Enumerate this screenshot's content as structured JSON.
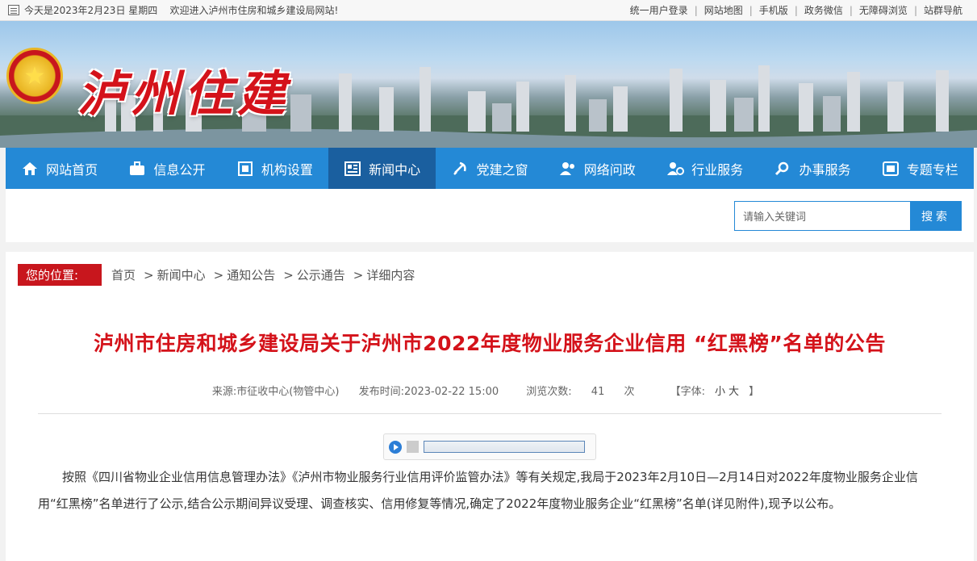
{
  "topbar": {
    "greeting": "今天是2023年2月23日 星期四    欢迎进入泸州市住房和城乡建设局网站!",
    "links": [
      "统一用户登录",
      "网站地图",
      "手机版",
      "政务微信",
      "无障碍浏览",
      "站群导航"
    ]
  },
  "banner": {
    "title": "泸州住建",
    "emblem_icon": "national-emblem"
  },
  "nav": {
    "items": [
      {
        "label": "网站首页",
        "icon": "home-icon"
      },
      {
        "label": "信息公开",
        "icon": "briefcase-icon"
      },
      {
        "label": "机构设置",
        "icon": "org-icon"
      },
      {
        "label": "新闻中心",
        "icon": "news-icon",
        "active": true
      },
      {
        "label": "党建之窗",
        "icon": "party-icon"
      },
      {
        "label": "网络问政",
        "icon": "people-icon"
      },
      {
        "label": "行业服务",
        "icon": "service-icon"
      },
      {
        "label": "办事服务",
        "icon": "search-icon"
      },
      {
        "label": "专题专栏",
        "icon": "column-icon"
      }
    ],
    "color": "#2489d6",
    "active_color": "#1a5f9f"
  },
  "search": {
    "placeholder": "请输入关键词",
    "button": "搜索"
  },
  "breadcrumb": {
    "label": "您的位置:",
    "items": [
      "首页",
      "新闻中心",
      "通知公告",
      "公示通告",
      "详细内容"
    ]
  },
  "article": {
    "title": "泸州市住房和城乡建设局关于泸州市2022年度物业服务企业信用 “红黑榜”名单的公告",
    "source": "来源:市征收中心(物管中心)",
    "publish_time": "发布时间:2023-02-22 15:00",
    "views_label": "浏览次数:",
    "views": "41",
    "views_unit": "次",
    "font_label": "【字体:",
    "font_small": "小",
    "font_large": "大",
    "font_close": "】",
    "body": "按照《四川省物业企业信用信息管理办法》《泸州市物业服务行业信用评价监管办法》等有关规定,我局于2023年2月10日—2月14日对2022年度物业服务企业信用“红黑榜”名单进行了公示,结合公示期间异议受理、调查核实、信用修复等情况,确定了2022年度物业服务企业“红黑榜”名单(详见附件),现予以公布。"
  },
  "colors": {
    "accent_red": "#d4121a",
    "nav_blue": "#2489d6"
  }
}
